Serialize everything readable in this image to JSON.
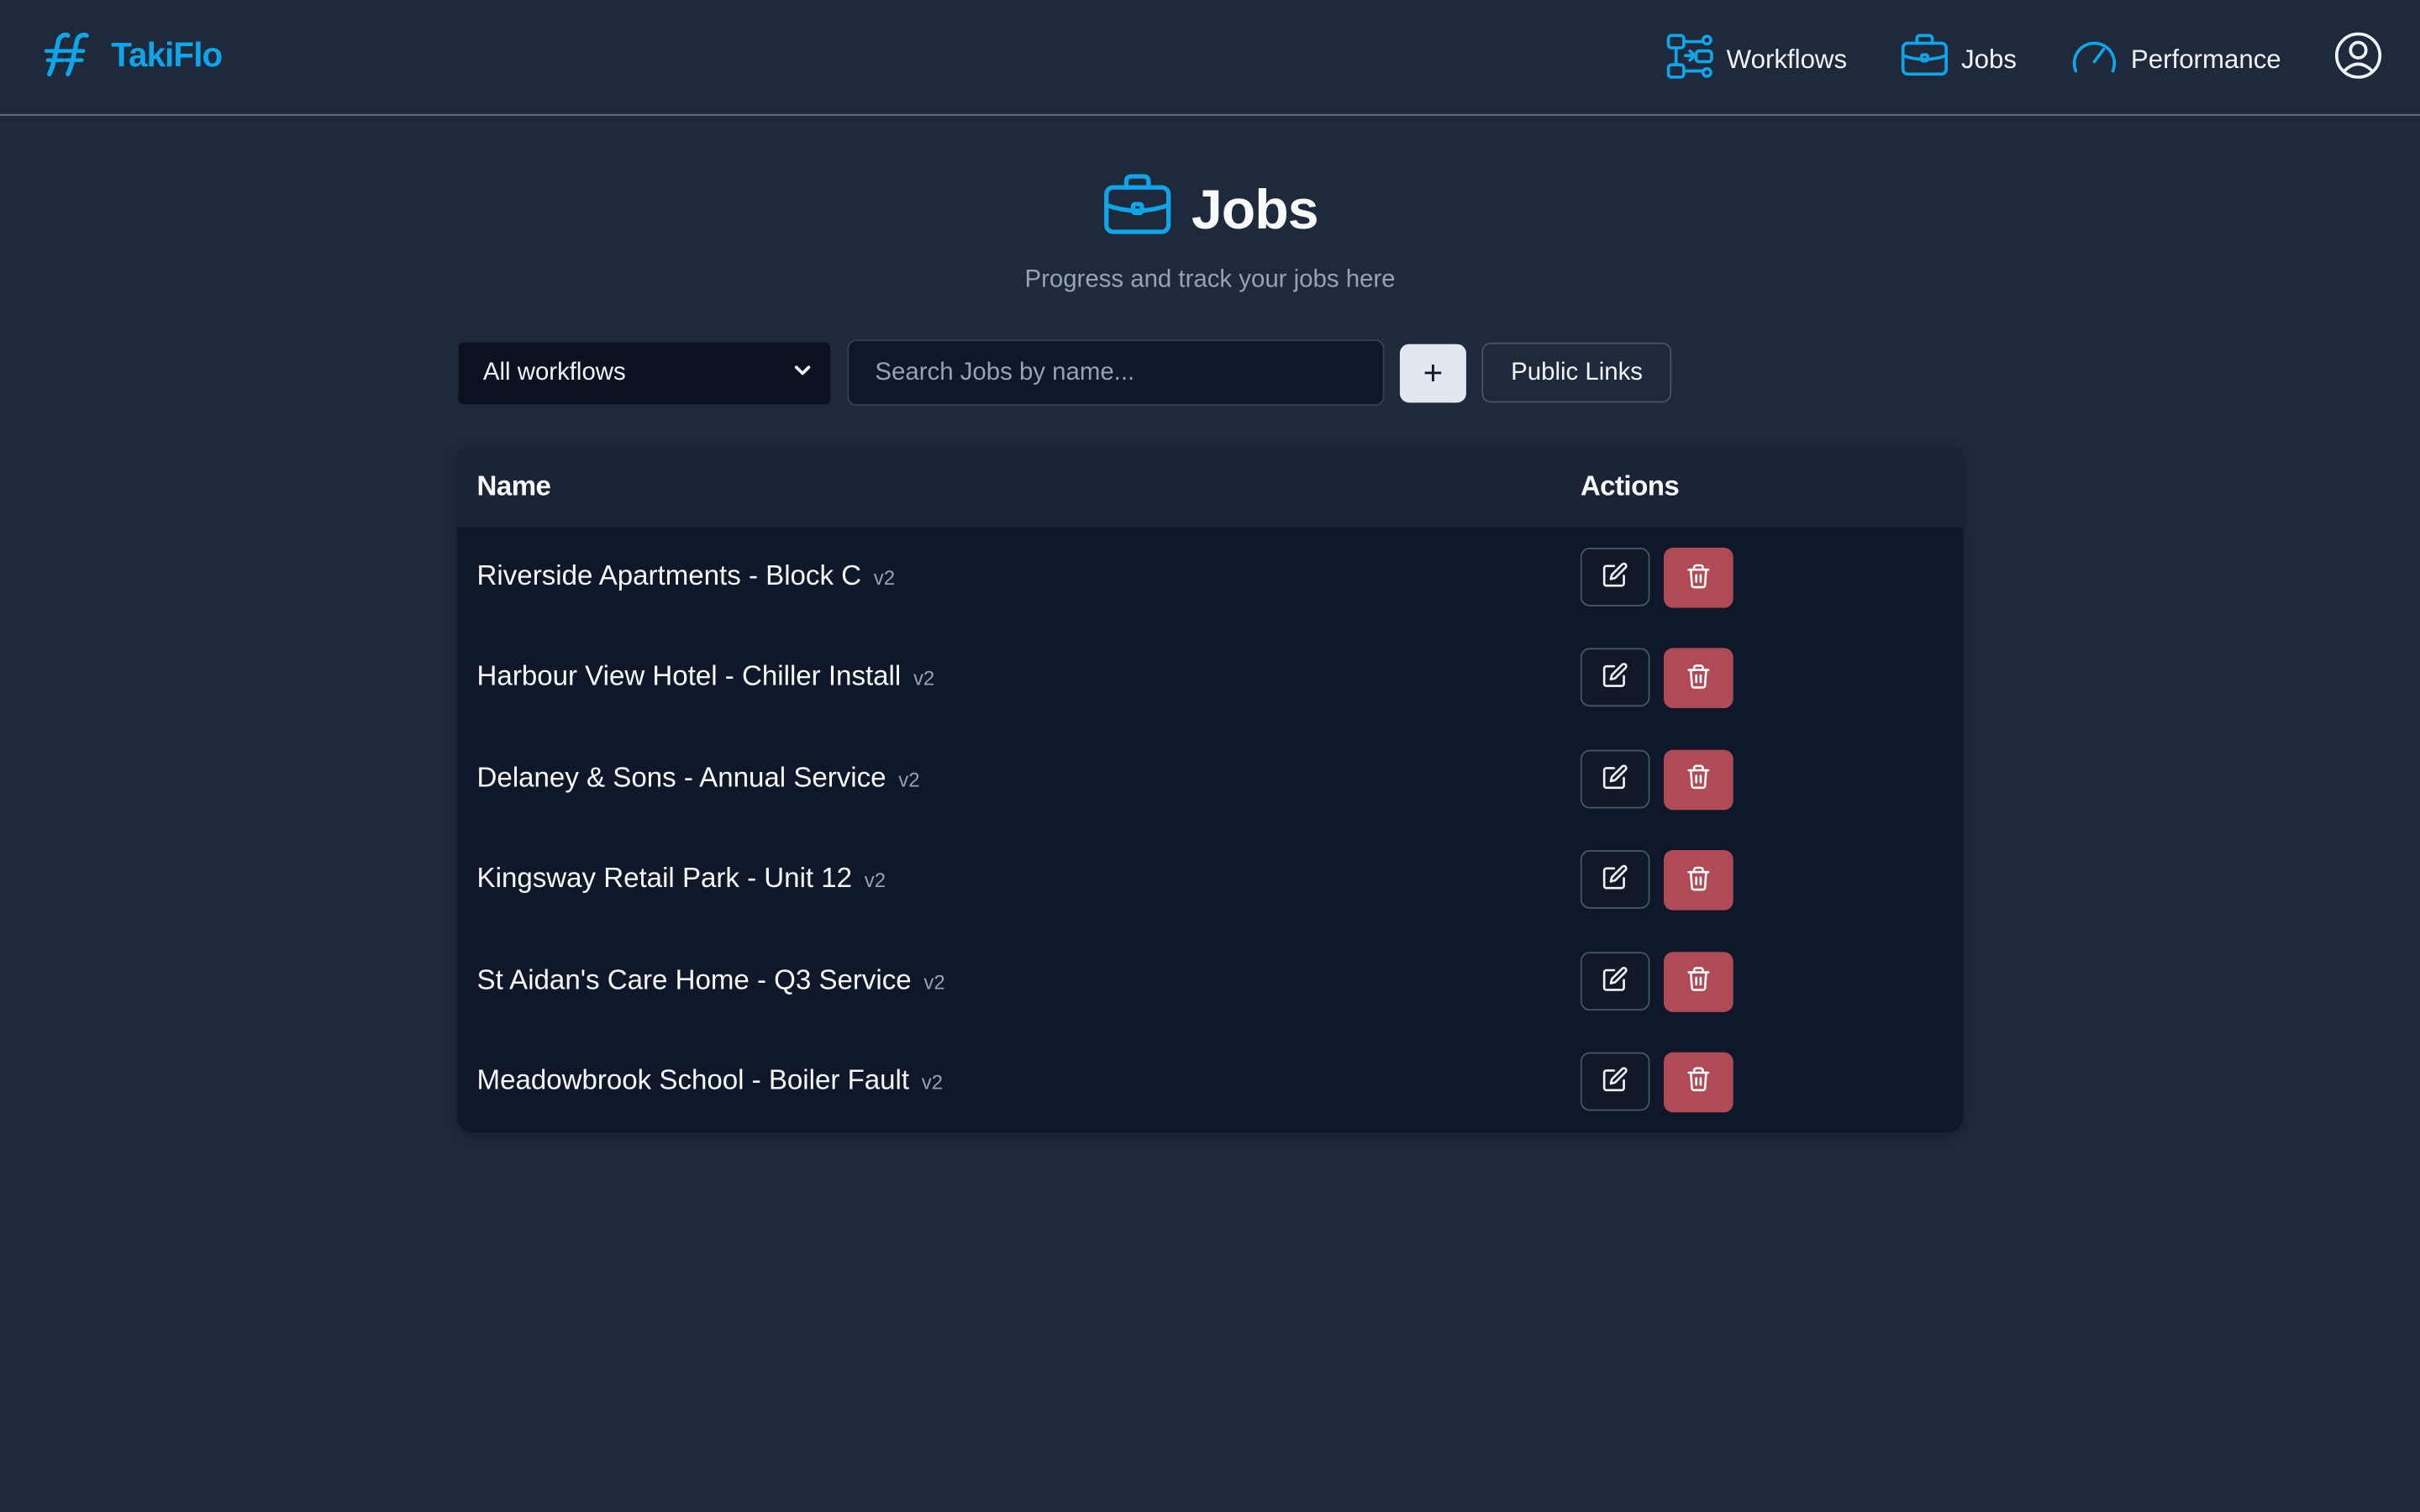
{
  "app": {
    "brand_name": "TakiFlo",
    "accent_color": "#0ea5e9"
  },
  "nav": {
    "items": [
      {
        "label": "Workflows",
        "icon": "workflow-icon"
      },
      {
        "label": "Jobs",
        "icon": "briefcase-icon"
      },
      {
        "label": "Performance",
        "icon": "gauge-icon"
      }
    ],
    "profile_icon": "user-circle-icon"
  },
  "page": {
    "title": "Jobs",
    "subtitle": "Progress and track your jobs here"
  },
  "toolbar": {
    "workflow_filter": {
      "selected": "All workflows"
    },
    "search_placeholder": "Search Jobs by name...",
    "add_label": "+",
    "public_links_label": "Public Links"
  },
  "table": {
    "columns": [
      "Name",
      "Actions"
    ],
    "rows": [
      {
        "name": "Riverside Apartments - Block C",
        "version": "v2"
      },
      {
        "name": "Harbour View Hotel - Chiller Install",
        "version": "v2"
      },
      {
        "name": "Delaney & Sons - Annual Service",
        "version": "v2"
      },
      {
        "name": "Kingsway Retail Park - Unit 12",
        "version": "v2"
      },
      {
        "name": "St Aidan's Care Home - Q3 Service",
        "version": "v2"
      },
      {
        "name": "Meadowbrook School - Boiler Fault",
        "version": "v2"
      }
    ]
  },
  "colors": {
    "background": "#1e293b",
    "table_background": "#0f172a",
    "delete_button": "#b04a55"
  }
}
